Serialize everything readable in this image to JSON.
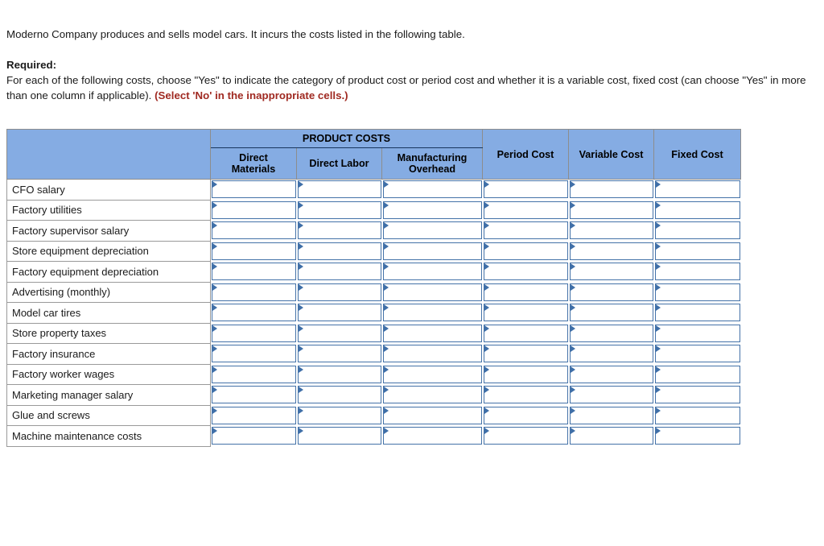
{
  "prose": {
    "intro": "Moderno Company produces and sells model cars. It incurs the costs listed in the following table.",
    "required_label": "Required:",
    "instructions_part1": "For each of the following costs, choose \"Yes\" to indicate the category of product cost or period cost and whether it is a variable cost, fixed cost (can choose \"Yes\" in more than one column if applicable). ",
    "instructions_warning": "(Select 'No' in the inappropriate cells.)"
  },
  "colors": {
    "header_blue": "#85ace3",
    "warning_red": "#a02a22",
    "cell_border_blue": "#4472a8",
    "group_rule": "#17365d"
  },
  "table": {
    "corner_header": "",
    "group_header": "PRODUCT COSTS",
    "columns": [
      {
        "key": "direct_materials",
        "label": "Direct\nMaterials",
        "line1": "Direct",
        "line2": "Materials",
        "group": "PRODUCT COSTS"
      },
      {
        "key": "direct_labor",
        "label": "Direct Labor",
        "line1": "Direct Labor",
        "line2": "",
        "group": "PRODUCT COSTS"
      },
      {
        "key": "manufacturing_overhead",
        "label": "Manufacturing\nOverhead",
        "line1": "Manufacturing",
        "line2": "Overhead",
        "group": "PRODUCT COSTS"
      },
      {
        "key": "period_cost",
        "label": "Period Cost",
        "line1": "Period Cost",
        "line2": "",
        "group": ""
      },
      {
        "key": "variable_cost",
        "label": "Variable Cost",
        "line1": "Variable Cost",
        "line2": "",
        "group": ""
      },
      {
        "key": "fixed_cost",
        "label": "Fixed Cost",
        "line1": "Fixed Cost",
        "line2": "",
        "group": ""
      }
    ],
    "rows": [
      {
        "label": "CFO salary",
        "values": [
          "",
          "",
          "",
          "",
          "",
          ""
        ]
      },
      {
        "label": "Factory utilities",
        "values": [
          "",
          "",
          "",
          "",
          "",
          ""
        ]
      },
      {
        "label": "Factory supervisor salary",
        "values": [
          "",
          "",
          "",
          "",
          "",
          ""
        ]
      },
      {
        "label": "Store equipment depreciation",
        "values": [
          "",
          "",
          "",
          "",
          "",
          ""
        ]
      },
      {
        "label": "Factory equipment depreciation",
        "values": [
          "",
          "",
          "",
          "",
          "",
          ""
        ]
      },
      {
        "label": "Advertising (monthly)",
        "values": [
          "",
          "",
          "",
          "",
          "",
          ""
        ]
      },
      {
        "label": "Model car tires",
        "values": [
          "",
          "",
          "",
          "",
          "",
          ""
        ]
      },
      {
        "label": "Store property taxes",
        "values": [
          "",
          "",
          "",
          "",
          "",
          ""
        ]
      },
      {
        "label": "Factory insurance",
        "values": [
          "",
          "",
          "",
          "",
          "",
          ""
        ]
      },
      {
        "label": "Factory worker wages",
        "values": [
          "",
          "",
          "",
          "",
          "",
          ""
        ]
      },
      {
        "label": "Marketing manager salary",
        "values": [
          "",
          "",
          "",
          "",
          "",
          ""
        ]
      },
      {
        "label": "Glue and screws",
        "values": [
          "",
          "",
          "",
          "",
          "",
          ""
        ]
      },
      {
        "label": "Machine maintenance costs",
        "values": [
          "",
          "",
          "",
          "",
          "",
          ""
        ]
      }
    ],
    "dropdown_options": [
      "Yes",
      "No"
    ]
  }
}
